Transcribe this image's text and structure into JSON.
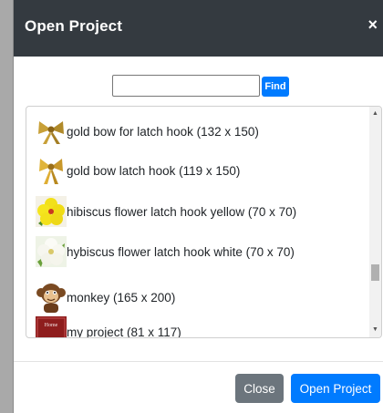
{
  "dialog": {
    "title": "Open Project",
    "close_icon": "×"
  },
  "search": {
    "value": "",
    "placeholder": "",
    "find_label": "Find"
  },
  "projects": [
    {
      "label": "gold bow for latch hook (132 x 150)",
      "icon": "gold-bow-thumbnail"
    },
    {
      "label": "gold bow latch hook (119 x 150)",
      "icon": "gold-bow-thumbnail"
    },
    {
      "label": "hibiscus flower latch hook yellow (70 x 70)",
      "icon": "yellow-hibiscus-thumbnail"
    },
    {
      "label": "hybiscus flower latch hook white (70 x 70)",
      "icon": "white-hibiscus-thumbnail"
    },
    {
      "label": "monkey (165 x 200)",
      "icon": "monkey-thumbnail"
    },
    {
      "label": "my project (81 x 117)",
      "icon": "home-sign-thumbnail"
    }
  ],
  "thumbnail_badge": "Home",
  "footer": {
    "close_label": "Close",
    "open_label": "Open Project"
  },
  "colors": {
    "header_bg": "#343a40",
    "primary": "#007bff",
    "secondary": "#6c757d"
  }
}
